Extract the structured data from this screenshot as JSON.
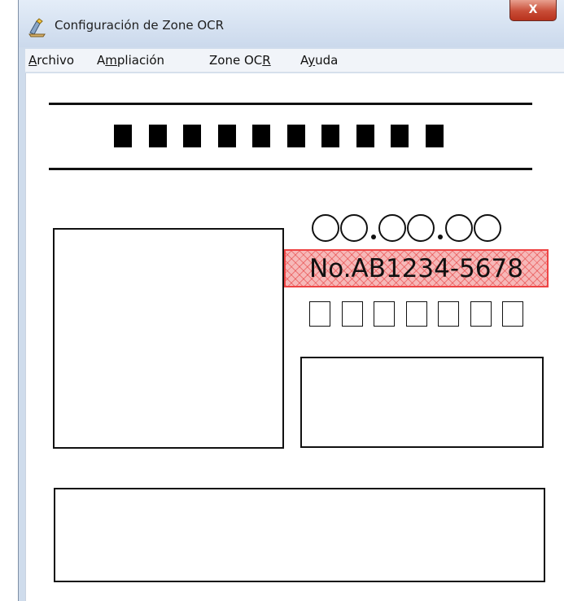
{
  "window": {
    "title": "Configuración de Zone OCR",
    "close_glyph": "X",
    "icon": "zone-ocr-app-icon"
  },
  "menu": {
    "items": [
      {
        "pre": "",
        "key": "A",
        "post": "rchivo"
      },
      {
        "pre": "A",
        "key": "m",
        "post": "pliación"
      },
      {
        "pre": "Zone OC",
        "key": "R",
        "post": ""
      },
      {
        "pre": "A",
        "key": "y",
        "post": "uda"
      }
    ]
  },
  "document": {
    "ocr_zone_text": "No.AB1234-5678",
    "ocr_zone_color": "#ee4444",
    "redacted_block_count": 10,
    "empty_square_count": 7,
    "circle_group_pattern": "OO.OO.OO"
  }
}
